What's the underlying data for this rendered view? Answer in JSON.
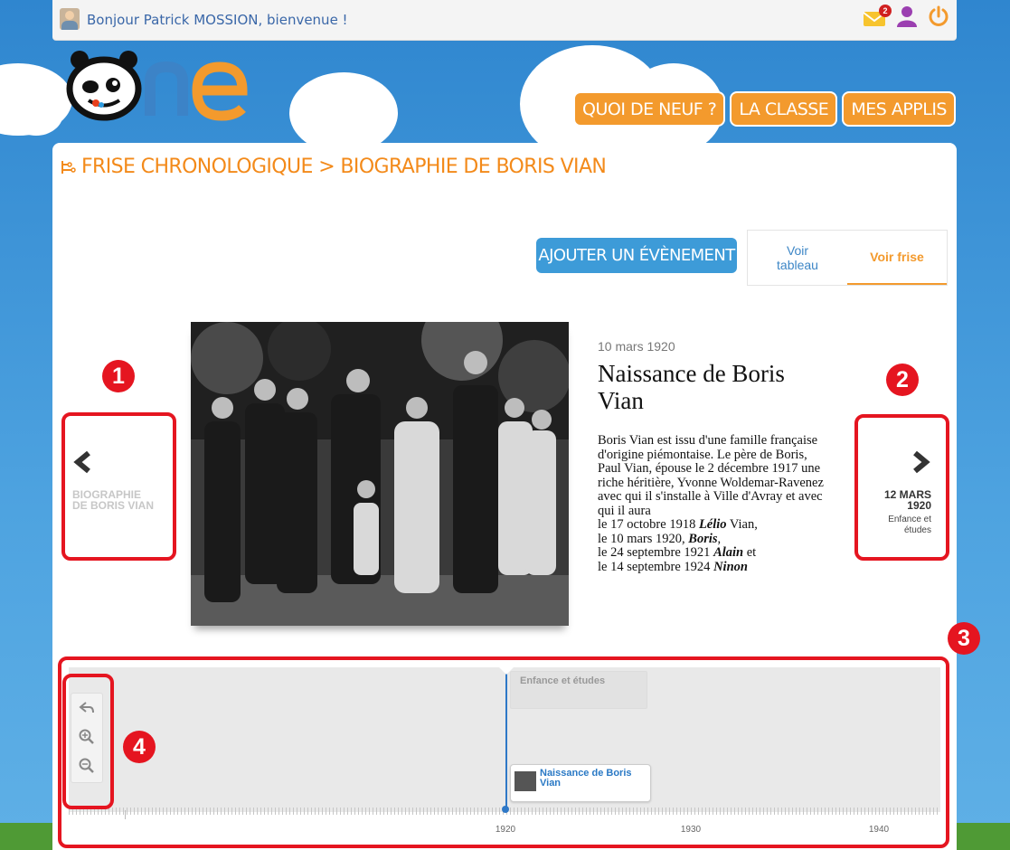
{
  "topbar": {
    "greeting": "Bonjour Patrick MOSSION, bienvenue !",
    "mail_badge": "2"
  },
  "nav": {
    "items": [
      "QUOI DE NEUF ?",
      "LA CLASSE",
      "MES APPLIS"
    ]
  },
  "breadcrumb": "FRISE CHRONOLOGIQUE > BIOGRAPHIE DE BORIS VIAN",
  "toolbar": {
    "add_event": "AJOUTER UN ÉVÈNEMENT",
    "view_table": "Voir tableau",
    "view_timeline": "Voir frise"
  },
  "slide": {
    "date": "10 mars 1920",
    "title": "Naissance de Boris Vian",
    "text_intro": "Boris Vian est issu d'une famille française d'origine piémontaise. Le père de Boris, Paul Vian, épouse le 2 décembre 1917 une riche héritière, Yvonne Woldemar-Ravenez avec qui il s'installe à Ville d'Avray et avec qui il aura",
    "children": [
      {
        "prefix": "le 17 octobre 1918 ",
        "name": "Lélio",
        "suffix": " Vian,"
      },
      {
        "prefix": "le 10 mars 1920, ",
        "name": "Boris",
        "suffix": ","
      },
      {
        "prefix": "le 24 septembre 1921 ",
        "name": "Alain",
        "suffix": " et"
      },
      {
        "prefix": "le 14 septembre 1924 ",
        "name": "Ninon",
        "suffix": ""
      }
    ]
  },
  "prev": {
    "label": "BIOGRAPHIE DE BORIS VIAN"
  },
  "next": {
    "date": "12 MARS 1920",
    "category": "Enfance et études"
  },
  "timeline": {
    "era_label": "Enfance et études",
    "event_label": "Naissance de Boris Vian",
    "years": [
      "1920",
      "1930",
      "1940"
    ]
  },
  "annotations": [
    "1",
    "2",
    "3",
    "4"
  ],
  "colors": {
    "accent_orange": "#f39a2d",
    "link_blue": "#3d86c6",
    "annotation_red": "#e51520",
    "timeline_blue": "#2e78c7"
  }
}
